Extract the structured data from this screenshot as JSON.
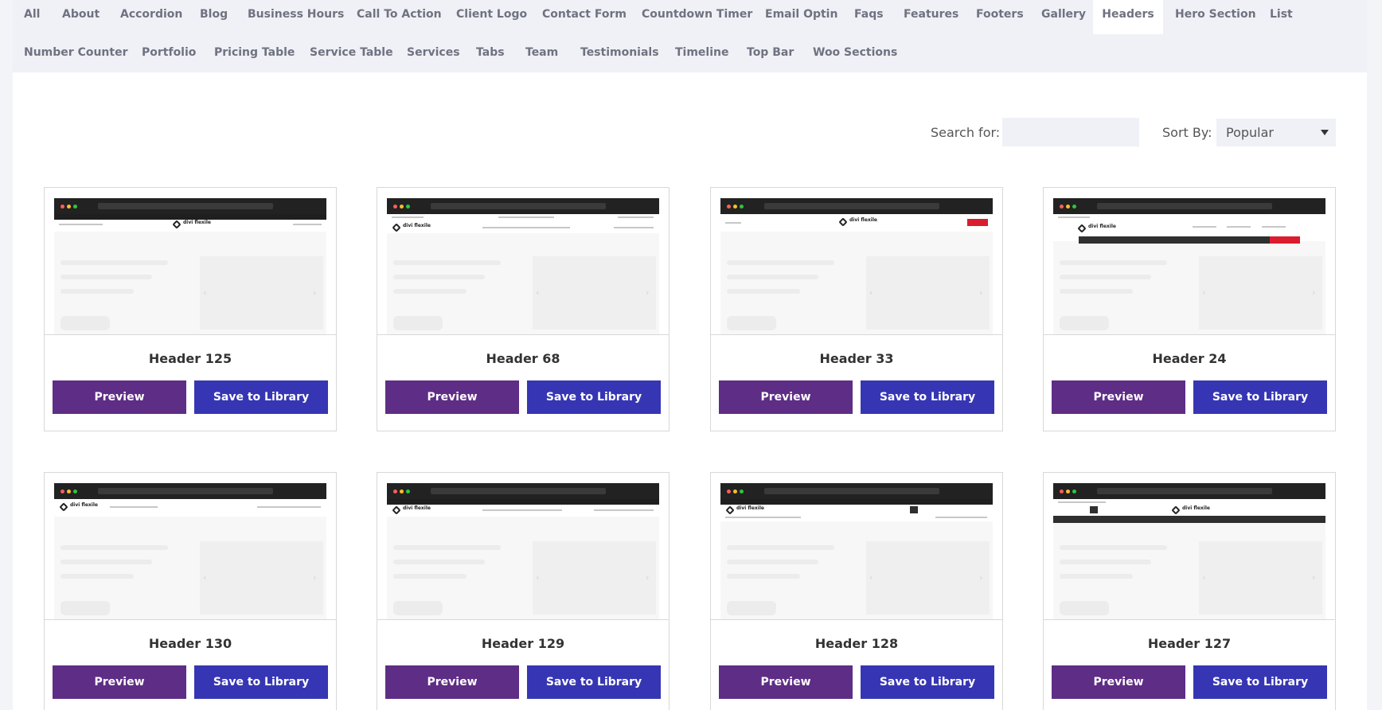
{
  "categories": {
    "row1": [
      "All",
      "About",
      "Accordion",
      "Blog",
      "Business Hours",
      "Call To Action",
      "Client Logo",
      "Contact Form",
      "Countdown Timer",
      "Email Optin",
      "Faqs",
      "Features",
      "Footers",
      "Gallery",
      "Headers",
      "Hero Section",
      "List"
    ],
    "row2": [
      "Number Counter",
      "Portfolio",
      "Pricing Table",
      "Service Table",
      "Services",
      "Tabs",
      "Team",
      "Testimonials",
      "Timeline",
      "Top Bar",
      "Woo Sections"
    ],
    "active": "Headers"
  },
  "toolbar": {
    "search_label": "Search for:",
    "search_value": "",
    "sort_label": "Sort By:",
    "sort_value": "Popular"
  },
  "thumbnail": {
    "logo_text": "divi flexile",
    "browser_dots": [
      "#ff5f57",
      "#febc2e",
      "#28c840"
    ]
  },
  "cards": [
    {
      "title": "Header 125",
      "preview_label": "Preview",
      "save_label": "Save to Library"
    },
    {
      "title": "Header 68",
      "preview_label": "Preview",
      "save_label": "Save to Library"
    },
    {
      "title": "Header 33",
      "preview_label": "Preview",
      "save_label": "Save to Library"
    },
    {
      "title": "Header 24",
      "preview_label": "Preview",
      "save_label": "Save to Library"
    },
    {
      "title": "Header 130",
      "preview_label": "Preview",
      "save_label": "Save to Library"
    },
    {
      "title": "Header 129",
      "preview_label": "Preview",
      "save_label": "Save to Library"
    },
    {
      "title": "Header 128",
      "preview_label": "Preview",
      "save_label": "Save to Library"
    },
    {
      "title": "Header 127",
      "preview_label": "Preview",
      "save_label": "Save to Library"
    }
  ],
  "colors": {
    "preview_button": "#5e2d85",
    "save_button": "#3636b4",
    "accent_red": "#d91d2e",
    "panel_bg": "#eff1f6"
  }
}
